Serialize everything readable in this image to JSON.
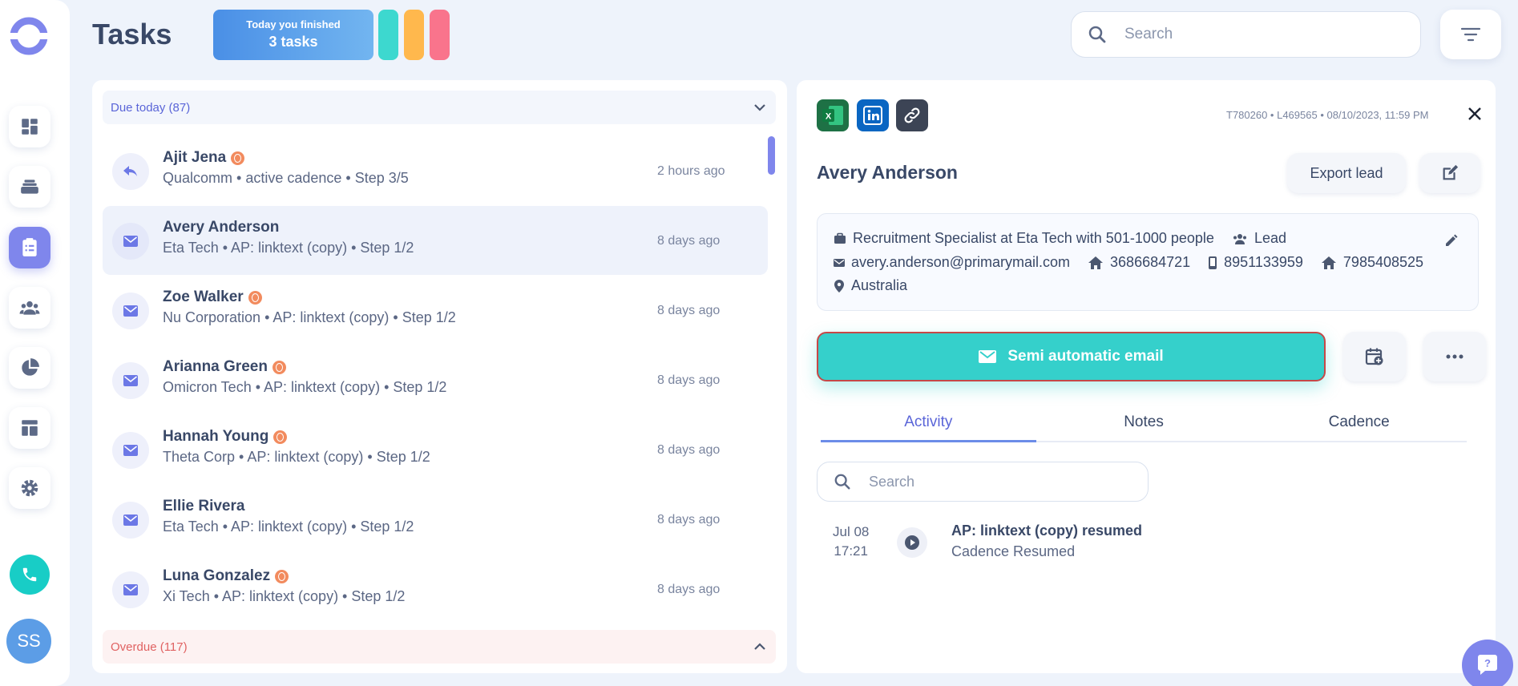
{
  "header": {
    "title": "Tasks",
    "finished_small": "Today you finished",
    "finished_big": "3 tasks",
    "pill_colors": [
      "#3dd8cf",
      "#ffb84d",
      "#f9748c"
    ],
    "search_placeholder": "Search"
  },
  "sidebar": {
    "items": [
      {
        "icon": "dashboard-icon"
      },
      {
        "icon": "layers-icon"
      },
      {
        "icon": "clipboard-icon",
        "active": true
      },
      {
        "icon": "people-icon"
      },
      {
        "icon": "pie-chart-icon"
      },
      {
        "icon": "layout-icon"
      },
      {
        "icon": "gear-icon"
      }
    ],
    "avatar": "SS"
  },
  "due_section": {
    "label": "Due today (87)"
  },
  "overdue_section": {
    "label": "Overdue (117)"
  },
  "tasks": [
    {
      "name": "Ajit Jena",
      "sub": "Qualcomm • active cadence • Step 3/5",
      "time": "2 hours ago",
      "icon": "reply-icon",
      "globe": true
    },
    {
      "name": "Avery Anderson",
      "sub": "Eta Tech • AP: linktext (copy) • Step 1/2",
      "time": "8 days ago",
      "icon": "mail-icon",
      "globe": false
    },
    {
      "name": "Zoe Walker",
      "sub": "Nu Corporation • AP: linktext (copy) • Step 1/2",
      "time": "8 days ago",
      "icon": "mail-icon",
      "globe": true
    },
    {
      "name": "Arianna Green",
      "sub": "Omicron Tech • AP: linktext (copy) • Step 1/2",
      "time": "8 days ago",
      "icon": "mail-icon",
      "globe": true
    },
    {
      "name": "Hannah Young",
      "sub": "Theta Corp • AP: linktext (copy) • Step 1/2",
      "time": "8 days ago",
      "icon": "mail-icon",
      "globe": true
    },
    {
      "name": "Ellie Rivera",
      "sub": "Eta Tech • AP: linktext (copy) • Step 1/2",
      "time": "8 days ago",
      "icon": "mail-icon",
      "globe": false
    },
    {
      "name": "Luna Gonzalez",
      "sub": "Xi Tech • AP: linktext (copy) • Step 1/2",
      "time": "8 days ago",
      "icon": "mail-icon",
      "globe": true
    }
  ],
  "detail": {
    "meta": "T780260 • L469565 • 08/10/2023, 11:59 PM",
    "name": "Avery Anderson",
    "export_label": "Export lead",
    "job": "Recruitment Specialist at Eta Tech with 501-1000 people",
    "type": "Lead",
    "email": "avery.anderson@primarymail.com",
    "phone1": "3686684721",
    "phone2": "8951133959",
    "phone3": "7985408525",
    "location": "Australia",
    "cta_label": "Semi automatic email",
    "tabs": [
      "Activity",
      "Notes",
      "Cadence"
    ],
    "search_placeholder": "Search",
    "activity": {
      "date": "Jul 08",
      "time": "17:21",
      "title": "AP: linktext (copy) resumed",
      "sub": "Cadence Resumed"
    }
  },
  "colors": {
    "accent": "#5a65d8",
    "teal": "#35d0cb",
    "overdue": "#e06262"
  }
}
